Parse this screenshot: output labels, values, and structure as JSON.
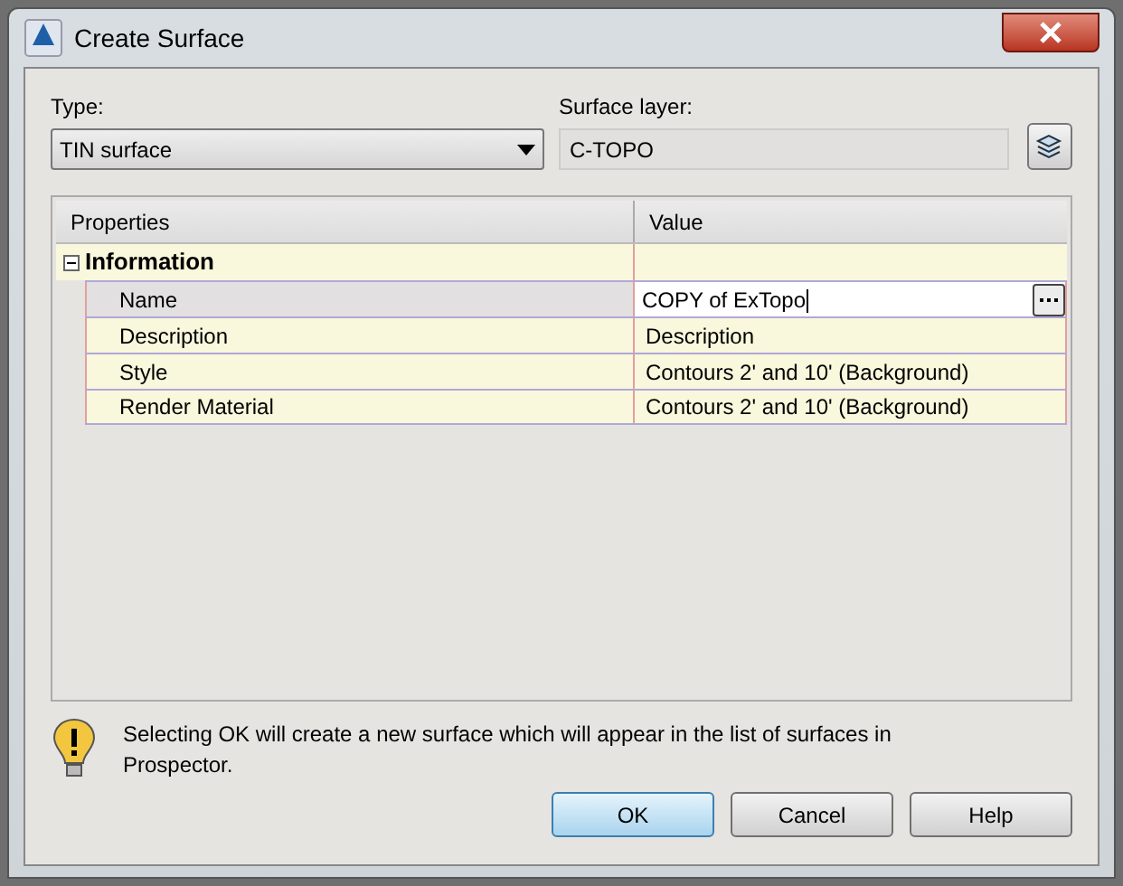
{
  "window": {
    "title": "Create Surface"
  },
  "type": {
    "label": "Type:",
    "value": "TIN surface"
  },
  "surface_layer": {
    "label": "Surface layer:",
    "value": "C-TOPO"
  },
  "grid": {
    "columns": [
      "Properties",
      "Value"
    ],
    "groups": [
      {
        "name": "Information",
        "expanded": true,
        "rows": [
          {
            "property": "Name",
            "value": "COPY of ExTopo",
            "editing": true
          },
          {
            "property": "Description",
            "value": "Description",
            "editing": false
          },
          {
            "property": "Style",
            "value": "Contours 2' and 10' (Background)",
            "editing": false
          },
          {
            "property": "Render Material",
            "value": "Contours 2' and 10' (Background)",
            "editing": false
          }
        ]
      }
    ]
  },
  "message": "Selecting OK will create a new surface which will appear in the list of surfaces in Prospector.",
  "buttons": [
    {
      "label": "OK",
      "default": true
    },
    {
      "label": "Cancel",
      "default": false
    },
    {
      "label": "Help",
      "default": false
    }
  ]
}
